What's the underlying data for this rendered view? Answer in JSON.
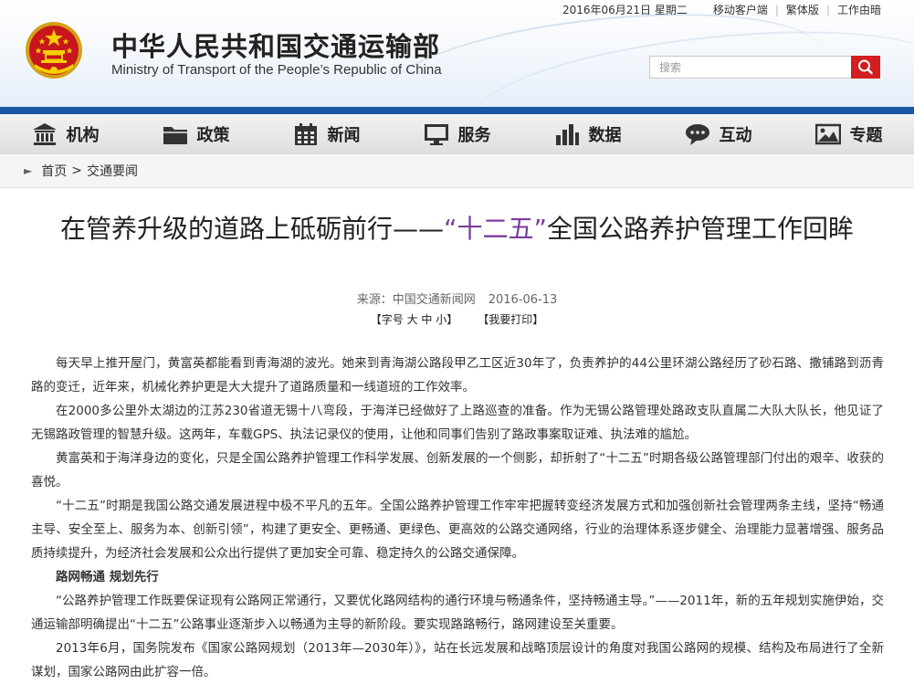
{
  "topbar": {
    "date": "2016年06月21日  星期二",
    "links": [
      "移动客户端",
      "繁体版",
      "工作由暗"
    ]
  },
  "header": {
    "title_cn": "中华人民共和国交通运输部",
    "title_en": "Ministry of Transport of the People’s Republic of China",
    "search_placeholder": "搜索"
  },
  "nav": [
    {
      "label": "机构",
      "icon": "building-icon"
    },
    {
      "label": "政策",
      "icon": "folder-icon"
    },
    {
      "label": "新闻",
      "icon": "calendar-icon"
    },
    {
      "label": "服务",
      "icon": "monitor-icon"
    },
    {
      "label": "数据",
      "icon": "bar-chart-icon"
    },
    {
      "label": "互动",
      "icon": "chat-icon"
    },
    {
      "label": "专题",
      "icon": "image-icon"
    }
  ],
  "breadcrumb": {
    "home": "首页",
    "sep": ">",
    "section": "交通要闻"
  },
  "article": {
    "title_pre": "在管养升级的道路上砥砺前行——",
    "title_quote": "“十二五”",
    "title_post": "全国公路养护管理工作回眸",
    "source_label": "来源：中国交通新闻网",
    "date": "2016-06-13",
    "font_size_tool": "【字号 大 中 小】",
    "print_tool": "【我要打印】",
    "paragraphs": [
      {
        "text": "每天早上推开屋门，黄富英都能看到青海湖的波光。她来到青海湖公路段甲乙工区近30年了，负责养护的44公里环湖公路经历了砂石路、撒铺路到沥青路的变迁，近年来，机械化养护更是大大提升了道路质量和一线道班的工作效率。",
        "sub": false
      },
      {
        "text": "在2000多公里外太湖边的江苏230省道无锡十八弯段，于海洋已经做好了上路巡查的准备。作为无锡公路管理处路政支队直属二大队大队长，他见证了无锡路政管理的智慧升级。这两年，车载GPS、执法记录仪的使用，让他和同事们告别了路政事案取证难、执法难的尴尬。",
        "sub": false
      },
      {
        "text": "黄富英和于海洋身边的变化，只是全国公路养护管理工作科学发展、创新发展的一个侧影，却折射了“十二五”时期各级公路管理部门付出的艰辛、收获的喜悦。",
        "sub": false
      },
      {
        "text": "“十二五”时期是我国公路交通发展进程中极不平凡的五年。全国公路养护管理工作牢牢把握转变经济发展方式和加强创新社会管理两条主线，坚持“畅通主导、安全至上、服务为本、创新引领”，构建了更安全、更畅通、更绿色、更高效的公路交通网络，行业的治理体系逐步健全、治理能力显著增强、服务品质持续提升，为经济社会发展和公众出行提供了更加安全可靠、稳定持久的公路交通保障。",
        "sub": false
      },
      {
        "text": "路网畅通  规划先行",
        "sub": true
      },
      {
        "text": "“公路养护管理工作既要保证现有公路网正常通行，又要优化路网结构的通行环境与畅通条件，坚持畅通主导。”——2011年，新的五年规划实施伊始，交通运输部明确提出“十二五”公路事业逐渐步入以畅通为主导的新阶段。要实现路路畅行，路网建设至关重要。",
        "sub": false
      },
      {
        "text": "2013年6月，国务院发布《国家公路网规划（2013年—2030年）》，站在长远发展和战略顶层设计的角度对我国公路网的规模、结构及布局进行了全新谋划，国家公路网由此扩容一倍。",
        "sub": false
      }
    ]
  },
  "colors": {
    "nav_blue": "#1b57a4",
    "search_red": "#d21e1e",
    "quote_purple": "#7a3c9c"
  }
}
